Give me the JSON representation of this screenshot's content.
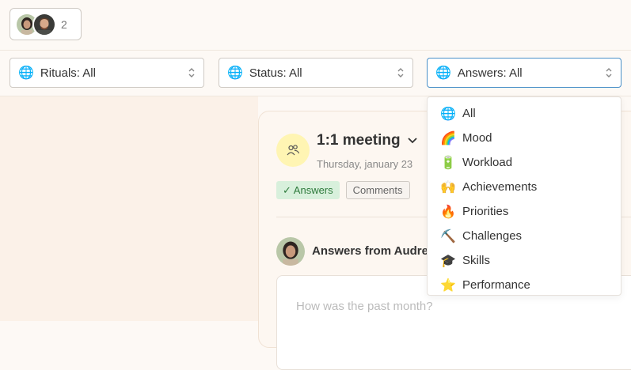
{
  "header": {
    "member_count": "2"
  },
  "filters": {
    "rituals": {
      "label": "Rituals: All",
      "icon": "globe-icon"
    },
    "status": {
      "label": "Status: All",
      "icon": "globe-icon"
    },
    "answers": {
      "label": "Answers: All",
      "icon": "globe-icon"
    }
  },
  "answers_dropdown": {
    "options": [
      {
        "emoji": "🌐",
        "label": "All"
      },
      {
        "emoji": "🌈",
        "label": "Mood"
      },
      {
        "emoji": "🔋",
        "label": "Workload"
      },
      {
        "emoji": "🙌",
        "label": "Achievements"
      },
      {
        "emoji": "🔥",
        "label": "Priorities"
      },
      {
        "emoji": "⛏️",
        "label": "Challenges"
      },
      {
        "emoji": "🎓",
        "label": "Skills"
      },
      {
        "emoji": "⭐",
        "label": "Performance"
      }
    ]
  },
  "ritual_card": {
    "title": "1:1 meeting",
    "date": "Thursday, january 23",
    "tabs": [
      {
        "label": "✓ Answers",
        "active": true
      },
      {
        "label": "Comments",
        "active": false
      }
    ],
    "answers_from": "Answers from Audre",
    "question_placeholder": "How was the past month?"
  },
  "colors": {
    "focus_border": "#4a90c8",
    "active_tab_bg": "#d8f0dc",
    "active_tab_text": "#2e7a3c",
    "ritual_icon_bg": "#fff5b3"
  }
}
